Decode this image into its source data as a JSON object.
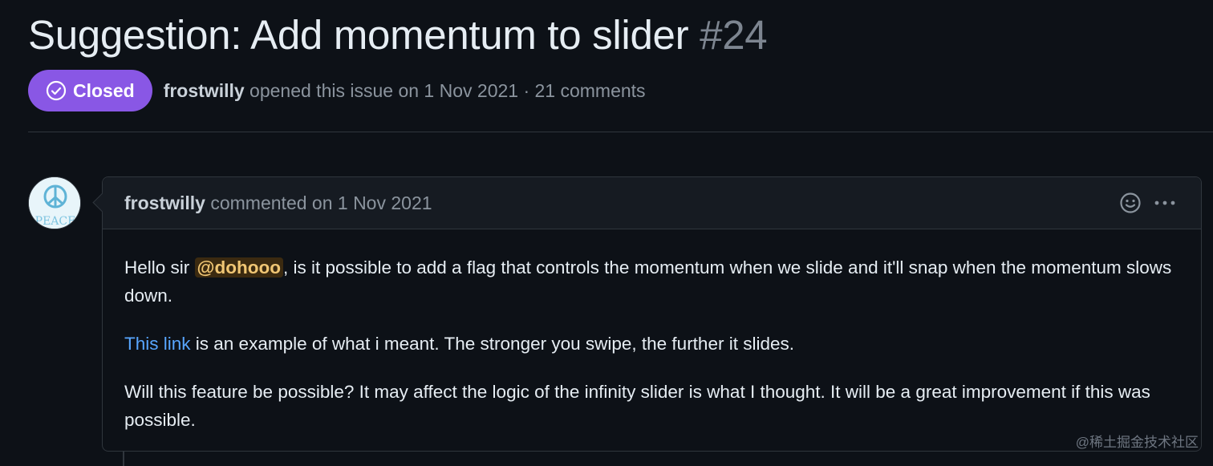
{
  "issue": {
    "title": "Suggestion: Add momentum to slider",
    "number": "#24",
    "state": "Closed",
    "author": "frostwilly",
    "meta_rest": " opened this issue on 1 Nov 2021 · 21 comments"
  },
  "comment": {
    "author": "frostwilly",
    "header_rest": " commented on 1 Nov 2021",
    "p1_before": "Hello sir ",
    "mention": "@dohooo",
    "p1_after": ", is it possible to add a flag that controls the momentum when we slide and it'll snap when the momentum slows down.",
    "link_text": "This link",
    "p2_after": " is an example of what i meant. The stronger you swipe, the further it slides.",
    "p3": "Will this feature be possible? It may affect the logic of the infinity slider is what I thought. It will be a great improvement if this was possible."
  },
  "avatar": {
    "text": "PEACE"
  },
  "watermark": "@稀土掘金技术社区",
  "colors": {
    "background": "#0d1117",
    "closed_badge": "#8957e5",
    "link": "#58a6ff",
    "mention_bg": "#3b2a10"
  },
  "icons": [
    "check-circle-icon",
    "smiley-icon",
    "kebab-horizontal-icon",
    "peace-icon"
  ]
}
